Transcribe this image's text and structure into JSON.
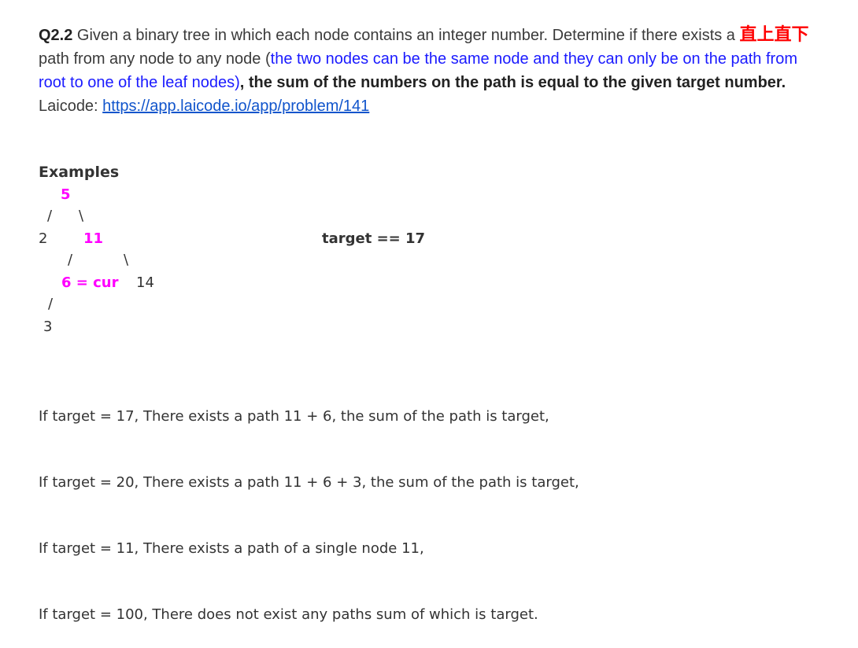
{
  "problem": {
    "qnum": "Q2.2",
    "intro": " Given a binary tree in which each node contains an integer number. Determine if there exists a ",
    "cn_term": "直上直下",
    "mid": " path from any node to any node (",
    "note": "the two nodes can be the same node and they can only be on the path from root to one of the leaf nodes)",
    "comma": ", the sum of the numbers on the path ",
    "strong": "is equal to the given target number.",
    "laicode_label": "Laicode: ",
    "laicode_url": "https://app.laicode.io/app/problem/141"
  },
  "examples_heading": "Examples",
  "tree": {
    "root": "5",
    "left": "2",
    "right": "11",
    "right_left": "6 = cur",
    "right_right": "14",
    "leaf": "3",
    "slash": "/",
    "backslash": "\\"
  },
  "target_label": "target == 17",
  "example_lines": [
    "If target = 17, There exists a path 11 + 6, the sum of the path is target,",
    "If target = 20, There exists a path 11 + 6 + 3, the sum of the path is target,",
    "If target = 11, There exists a path of a single node 11,",
    "If target = 100, There does not exist any paths sum of which is target."
  ]
}
